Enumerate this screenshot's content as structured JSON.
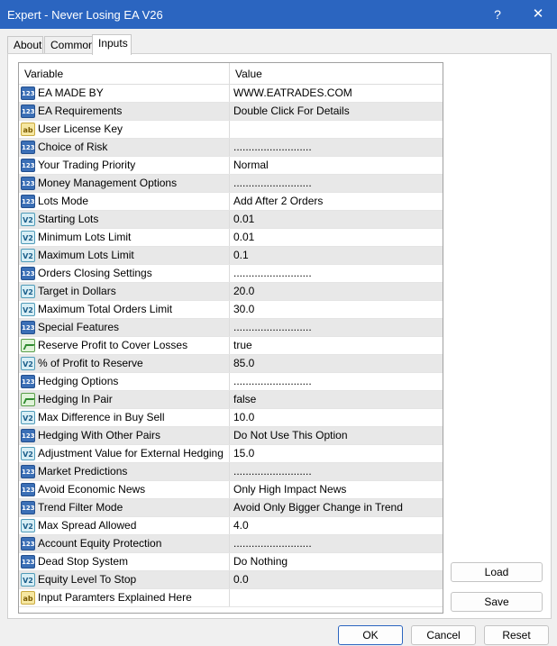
{
  "window": {
    "title": "Expert - Never Losing EA V26",
    "help_glyph": "?",
    "close_glyph": "✕"
  },
  "tabs": [
    {
      "label": "About"
    },
    {
      "label": "Common"
    },
    {
      "label": "Inputs"
    }
  ],
  "grid": {
    "headers": {
      "variable": "Variable",
      "value": "Value"
    },
    "rows": [
      {
        "icon": "int-icon",
        "variable": "EA MADE BY",
        "value": "WWW.EATRADES.COM"
      },
      {
        "icon": "int-icon",
        "variable": "EA Requirements",
        "value": "Double Click For Details"
      },
      {
        "icon": "string-icon",
        "variable": "User License Key",
        "value": ""
      },
      {
        "icon": "int-icon",
        "variable": "Choice of Risk",
        "value": ".........................."
      },
      {
        "icon": "int-icon",
        "variable": "Your Trading Priority",
        "value": "Normal"
      },
      {
        "icon": "int-icon",
        "variable": "Money Management Options",
        "value": ".........................."
      },
      {
        "icon": "int-icon",
        "variable": "Lots Mode",
        "value": "Add After 2 Orders"
      },
      {
        "icon": "double-icon",
        "variable": "Starting Lots",
        "value": "0.01"
      },
      {
        "icon": "double-icon",
        "variable": "Minimum Lots Limit",
        "value": "0.01"
      },
      {
        "icon": "double-icon",
        "variable": "Maximum Lots Limit",
        "value": "0.1"
      },
      {
        "icon": "int-icon",
        "variable": "Orders Closing Settings",
        "value": ".........................."
      },
      {
        "icon": "double-icon",
        "variable": "Target in Dollars",
        "value": "20.0"
      },
      {
        "icon": "double-icon",
        "variable": "Maximum Total Orders Limit",
        "value": "30.0"
      },
      {
        "icon": "int-icon",
        "variable": "Special Features",
        "value": ".........................."
      },
      {
        "icon": "bool-icon",
        "variable": "Reserve Profit to Cover Losses",
        "value": "true"
      },
      {
        "icon": "double-icon",
        "variable": "% of Profit to Reserve",
        "value": "85.0"
      },
      {
        "icon": "int-icon",
        "variable": "Hedging Options",
        "value": ".........................."
      },
      {
        "icon": "bool-icon",
        "variable": "Hedging In Pair",
        "value": "false"
      },
      {
        "icon": "double-icon",
        "variable": "Max Difference in Buy Sell",
        "value": "10.0"
      },
      {
        "icon": "int-icon",
        "variable": "Hedging With Other Pairs",
        "value": "Do Not Use This Option"
      },
      {
        "icon": "double-icon",
        "variable": "Adjustment Value for External Hedging",
        "value": "15.0"
      },
      {
        "icon": "int-icon",
        "variable": "Market Predictions",
        "value": ".........................."
      },
      {
        "icon": "int-icon",
        "variable": "Avoid Economic News",
        "value": "Only High Impact News"
      },
      {
        "icon": "int-icon",
        "variable": "Trend Filter Mode",
        "value": "Avoid Only Bigger Change in Trend"
      },
      {
        "icon": "double-icon",
        "variable": "Max Spread Allowed",
        "value": "4.0"
      },
      {
        "icon": "int-icon",
        "variable": "Account Equity Protection",
        "value": ".........................."
      },
      {
        "icon": "int-icon",
        "variable": "Dead Stop System",
        "value": "Do Nothing"
      },
      {
        "icon": "double-icon",
        "variable": "Equity Level To Stop",
        "value": "0.0"
      },
      {
        "icon": "string-icon",
        "variable": "Input Paramters Explained Here",
        "value": ""
      }
    ]
  },
  "icon_glyphs": {
    "int-icon": "123",
    "double-icon": "V2",
    "string-icon": "ab",
    "bool-icon": ""
  },
  "side_buttons": {
    "load_label": "Load",
    "save_label": "Save"
  },
  "footer_buttons": {
    "ok_label": "OK",
    "cancel_label": "Cancel",
    "reset_label": "Reset"
  },
  "colors": {
    "titlebar": "#2b65c0",
    "alt_row": "#e8e8e8"
  }
}
